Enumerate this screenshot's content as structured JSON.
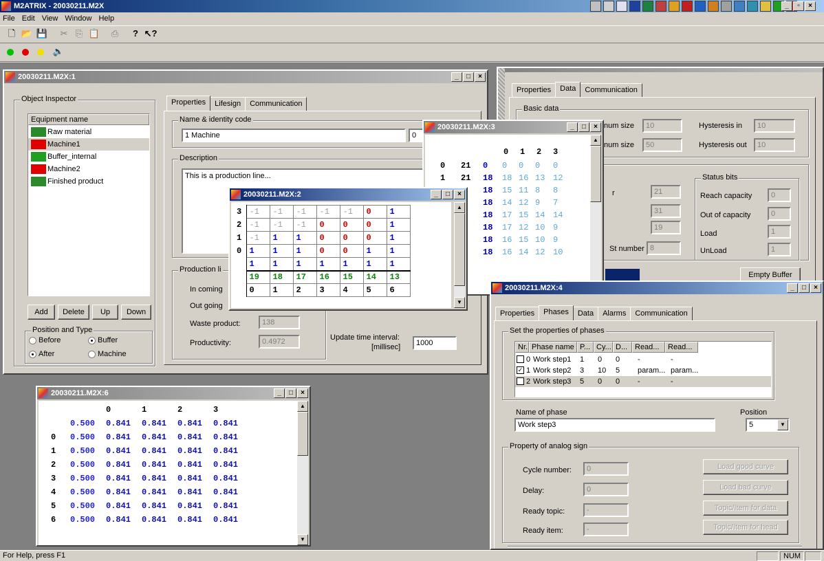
{
  "app": {
    "title": "M2ATRIX - 20030211.M2X"
  },
  "menu": [
    "File",
    "Edit",
    "View",
    "Window",
    "Help"
  ],
  "status": {
    "help": "For Help, press F1",
    "num": "NUM"
  },
  "w1": {
    "title": "20030211.M2X:1",
    "inspector": "Object Inspector",
    "list_header": "Equipment name",
    "items": [
      {
        "name": "Raw material",
        "icon_color": "#2a8a2a"
      },
      {
        "name": "Machine1",
        "icon_color": "#e00000"
      },
      {
        "name": "Buffer_internal",
        "icon_color": "#20a020"
      },
      {
        "name": "Machine2",
        "icon_color": "#e00000"
      },
      {
        "name": "Finished product",
        "icon_color": "#2a8a2a"
      }
    ],
    "buttons": [
      "Add",
      "Delete",
      "Up",
      "Down"
    ],
    "pos_group": "Position and Type",
    "radios": [
      {
        "label": "Before",
        "on": false
      },
      {
        "label": "Buffer",
        "on": true
      },
      {
        "label": "After",
        "on": true
      },
      {
        "label": "Machine",
        "on": false
      }
    ],
    "tabs": [
      "Properties",
      "Lifesign",
      "Communication"
    ],
    "name_group": "Name & identity code",
    "name_value": "1 Machine",
    "id_value": "0",
    "desc_group": "Description",
    "desc_value": "This is a production line...",
    "prod_group": "Production li",
    "incoming": "In coming",
    "outgoing": "Out going",
    "waste_label": "Waste product:",
    "waste_value": "138",
    "prod_label": "Productivity:",
    "prod_value": "0.4972",
    "update_label": "Update time interval:",
    "update_unit": "[millisec]",
    "update_value": "1000"
  },
  "w2": {
    "title": "20030211.M2X:2",
    "rows": [
      {
        "h": "3",
        "c": [
          [
            "-1",
            "g"
          ],
          [
            "-1",
            "g"
          ],
          [
            "-1",
            "g"
          ],
          [
            "-1",
            "g"
          ],
          [
            "-1",
            "g"
          ],
          [
            "0",
            "r"
          ],
          [
            "1",
            "b"
          ]
        ]
      },
      {
        "h": "2",
        "c": [
          [
            "-1",
            "g"
          ],
          [
            "-1",
            "g"
          ],
          [
            "-1",
            "g"
          ],
          [
            "0",
            "r"
          ],
          [
            "0",
            "r"
          ],
          [
            "0",
            "r"
          ],
          [
            "1",
            "b"
          ]
        ]
      },
      {
        "h": "1",
        "c": [
          [
            "-1",
            "g"
          ],
          [
            "1",
            "b"
          ],
          [
            "1",
            "b"
          ],
          [
            "0",
            "r"
          ],
          [
            "0",
            "r"
          ],
          [
            "0",
            "r"
          ],
          [
            "1",
            "b"
          ]
        ]
      },
      {
        "h": "0",
        "c": [
          [
            "1",
            "b"
          ],
          [
            "1",
            "b"
          ],
          [
            "1",
            "b"
          ],
          [
            "0",
            "r"
          ],
          [
            "0",
            "r"
          ],
          [
            "1",
            "b"
          ],
          [
            "1",
            "b"
          ]
        ]
      },
      {
        "h": "",
        "c": [
          [
            "1",
            "b"
          ],
          [
            "1",
            "b"
          ],
          [
            "1",
            "b"
          ],
          [
            "1",
            "b"
          ],
          [
            "1",
            "b"
          ],
          [
            "1",
            "b"
          ],
          [
            "1",
            "b"
          ]
        ]
      },
      {
        "h": "",
        "c": [
          [
            "19",
            "gr"
          ],
          [
            "18",
            "gr"
          ],
          [
            "17",
            "gr"
          ],
          [
            "16",
            "gr"
          ],
          [
            "15",
            "gr"
          ],
          [
            "14",
            "gr"
          ],
          [
            "13",
            "gr"
          ]
        ]
      },
      {
        "h": "",
        "c": [
          [
            "0",
            "k"
          ],
          [
            "1",
            "k"
          ],
          [
            "2",
            "k"
          ],
          [
            "3",
            "k"
          ],
          [
            "4",
            "k"
          ],
          [
            "5",
            "k"
          ],
          [
            "6",
            "k"
          ]
        ]
      }
    ]
  },
  "w3": {
    "title": "20030211.M2X:3",
    "cols": [
      "0",
      "1",
      "2",
      "3"
    ],
    "rows": [
      {
        "h": "0",
        "v": [
          "21",
          "0",
          "0",
          "0",
          "0",
          "0"
        ]
      },
      {
        "h": "1",
        "v": [
          "21",
          "18",
          "18",
          "16",
          "13",
          "12"
        ]
      },
      {
        "h": "",
        "v": [
          "",
          "18",
          "15",
          "11",
          "8",
          "8"
        ]
      },
      {
        "h": "",
        "v": [
          "",
          "18",
          "14",
          "12",
          "9",
          "7"
        ]
      },
      {
        "h": "",
        "v": [
          "",
          "18",
          "17",
          "15",
          "14",
          "14"
        ]
      },
      {
        "h": "",
        "v": [
          "",
          "18",
          "17",
          "12",
          "10",
          "9"
        ]
      },
      {
        "h": "",
        "v": [
          "",
          "18",
          "16",
          "15",
          "10",
          "9"
        ]
      },
      {
        "h": "",
        "v": [
          "",
          "18",
          "16",
          "14",
          "12",
          "10"
        ]
      }
    ]
  },
  "wr": {
    "tabs": [
      "Properties",
      "Data",
      "Communication"
    ],
    "basic": "Basic data",
    "max_label": "num size",
    "max_value": "10",
    "min_label": "num size",
    "min_value": "50",
    "hyst_in_label": "Hysteresis in",
    "hyst_in_value": "10",
    "hyst_out_label": "Hysteresis out",
    "hyst_out_value": "10",
    "f1_label": "r",
    "f1": "21",
    "f2": "31",
    "f3": "19",
    "st_label": "St number",
    "st_value": "8",
    "status_group": "Status bits",
    "reach_label": "Reach capacity",
    "reach_value": "0",
    "outcap_label": "Out of capacity",
    "outcap_value": "0",
    "load_label": "Load",
    "load_value": "1",
    "unload_label": "UnLoad",
    "unload_value": "1",
    "empty_btn": "Empty Buffer"
  },
  "w4": {
    "title": "20030211.M2X:4",
    "tabs": [
      "Properties",
      "Phases",
      "Data",
      "Alarms",
      "Communication"
    ],
    "group": "Set the properties of phases",
    "headers": [
      "Nr.",
      "Phase name",
      "P...",
      "Cy...",
      "D...",
      "Read...",
      "Read..."
    ],
    "rows": [
      {
        "checked": false,
        "nr": "0",
        "name": "Work step1",
        "p": "1",
        "cy": "0",
        "d": "0",
        "r1": "-",
        "r2": "-"
      },
      {
        "checked": true,
        "nr": "1",
        "name": "Work step2",
        "p": "3",
        "cy": "10",
        "d": "5",
        "r1": "param...",
        "r2": "param..."
      },
      {
        "checked": false,
        "nr": "2",
        "name": "Work step3",
        "p": "5",
        "cy": "0",
        "d": "0",
        "r1": "-",
        "r2": "-"
      }
    ],
    "name_label": "Name of phase",
    "name_value": "Work step3",
    "pos_label": "Position",
    "pos_value": "5",
    "analog_group": "Property of analog sign",
    "cycle_label": "Cycle number:",
    "cycle_value": "0",
    "delay_label": "Delay:",
    "delay_value": "0",
    "rtopic_label": "Ready topic:",
    "rtopic_value": "-",
    "ritem_label": "Ready item:",
    "ritem_value": "-",
    "btn_good": "Load good curve",
    "btn_bad": "Load bad curve",
    "btn_topic": "Topic/Item for data",
    "btn_head": "Topic/Item for head"
  },
  "w6": {
    "title": "20030211.M2X:6",
    "cols": [
      "0",
      "1",
      "2",
      "3"
    ],
    "rows": [
      {
        "h": "",
        "v": [
          "0.500",
          "0.841",
          "0.841",
          "0.841",
          "0.841"
        ]
      },
      {
        "h": "0",
        "v": [
          "0.500",
          "0.841",
          "0.841",
          "0.841",
          "0.841"
        ]
      },
      {
        "h": "1",
        "v": [
          "0.500",
          "0.841",
          "0.841",
          "0.841",
          "0.841"
        ]
      },
      {
        "h": "2",
        "v": [
          "0.500",
          "0.841",
          "0.841",
          "0.841",
          "0.841"
        ]
      },
      {
        "h": "3",
        "v": [
          "0.500",
          "0.841",
          "0.841",
          "0.841",
          "0.841"
        ]
      },
      {
        "h": "4",
        "v": [
          "0.500",
          "0.841",
          "0.841",
          "0.841",
          "0.841"
        ]
      },
      {
        "h": "5",
        "v": [
          "0.500",
          "0.841",
          "0.841",
          "0.841",
          "0.841"
        ]
      },
      {
        "h": "6",
        "v": [
          "0.500",
          "0.841",
          "0.841",
          "0.841",
          "0.841"
        ]
      }
    ]
  }
}
